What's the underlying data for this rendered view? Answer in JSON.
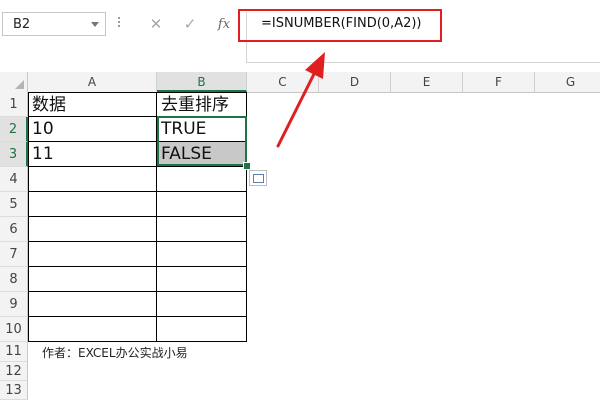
{
  "name_box": {
    "value": "B2"
  },
  "formula_bar": {
    "cancel_glyph": "✕",
    "enter_glyph": "✓",
    "fx_label": "fx",
    "formula": "=ISNUMBER(FIND(0,A2))"
  },
  "columns": [
    "A",
    "B",
    "C",
    "D",
    "E",
    "F",
    "G"
  ],
  "rows": [
    "1",
    "2",
    "3",
    "4",
    "5",
    "6",
    "7",
    "8",
    "9",
    "10",
    "11",
    "12",
    "13"
  ],
  "cells": {
    "A1": "数据",
    "B1": "去重排序",
    "A2": "10",
    "B2": "TRUE",
    "A3": "11",
    "B3": "FALSE"
  },
  "credit": "作者：EXCEL办公实战小易",
  "colors": {
    "accent_green": "#217346",
    "annotation_red": "#e02020",
    "highlight_gray": "#c8c8c8"
  }
}
